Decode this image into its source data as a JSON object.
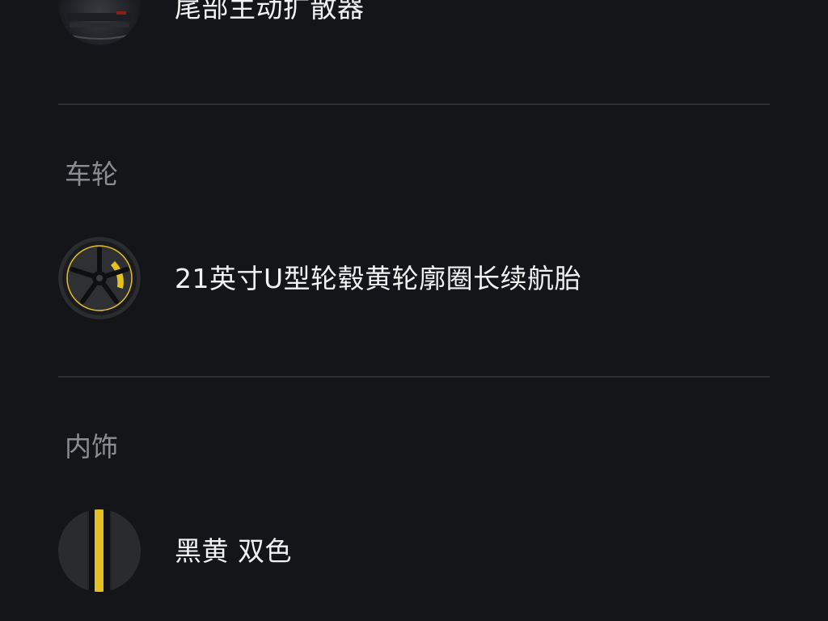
{
  "options": {
    "rear": {
      "label": "尾部主动扩散器",
      "icon": "rear-diffuser-thumbnail"
    },
    "wheels": {
      "section_title": "车轮",
      "label": "21英寸U型轮毂黄轮廓圈长续航胎",
      "icon": "wheel-thumbnail"
    },
    "interior": {
      "section_title": "内饰",
      "label": "黑黄 双色",
      "icon": "interior-swatch-thumbnail"
    }
  },
  "colors": {
    "background": "#141518",
    "divider": "#2d2e33",
    "section_title": "#8c8d92",
    "accent_yellow": "#e5c021"
  }
}
